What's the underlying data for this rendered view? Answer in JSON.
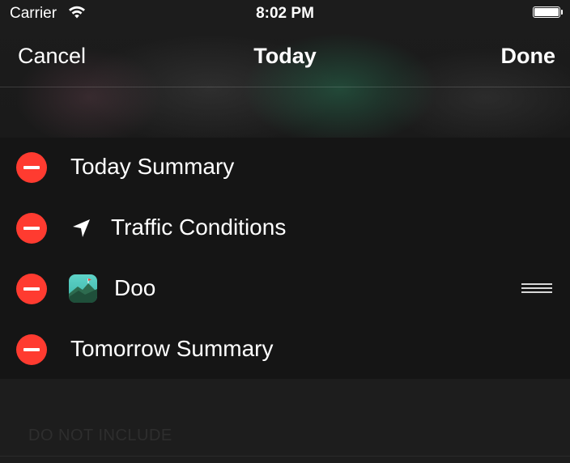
{
  "status_bar": {
    "carrier": "Carrier",
    "time": "8:02 PM",
    "wifi_icon": "wifi-icon",
    "battery_icon": "battery-full-icon"
  },
  "nav": {
    "cancel_label": "Cancel",
    "title": "Today",
    "done_label": "Done"
  },
  "widgets": [
    {
      "label": "Today Summary",
      "icon": null
    },
    {
      "label": "Traffic Conditions",
      "icon": "location-arrow-icon"
    },
    {
      "label": "Doo",
      "icon": "doo-app-icon",
      "reorder": true
    },
    {
      "label": "Tomorrow Summary",
      "icon": null
    }
  ],
  "section": {
    "do_not_include_header": "DO NOT INCLUDE"
  },
  "colors": {
    "delete_red": "#ff3b30",
    "background": "#151515",
    "text": "#ffffff"
  }
}
